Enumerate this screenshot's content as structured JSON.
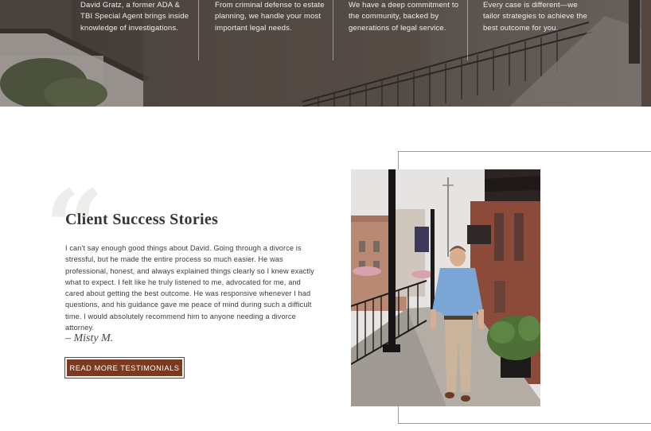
{
  "hero": {
    "columns": [
      {
        "text": "David Gratz, a former ADA & TBI Special Agent brings inside knowledge of investigations."
      },
      {
        "text": "From criminal defense to estate planning, we handle your most important legal needs."
      },
      {
        "text": "We have a deep commitment to the community, backed by generations of legal service."
      },
      {
        "text": "Every case is different—we tailor strategies to achieve the best outcome for you."
      }
    ]
  },
  "testimonials": {
    "quote_mark": "“",
    "title": "Client Success Stories",
    "text": "I can't say enough good things about David. Going through a divorce is stressful, but he made the entire process so much easier. He was professional, honest, and always explained things clearly so I knew exactly what to expect. I felt like he truly listened to me, advocated for me, and cared about getting the best outcome. He was responsive whenever I had questions, and his guidance gave me peace of mind during such a difficult time. I would absolutely recommend him to anyone needing a divorce attorney.",
    "author": "– Misty M.",
    "button_label": "READ MORE TESTIMONIALS"
  },
  "colors": {
    "accent": "#7a3a20",
    "title": "#3a3533",
    "body_text": "#3f3a37"
  }
}
